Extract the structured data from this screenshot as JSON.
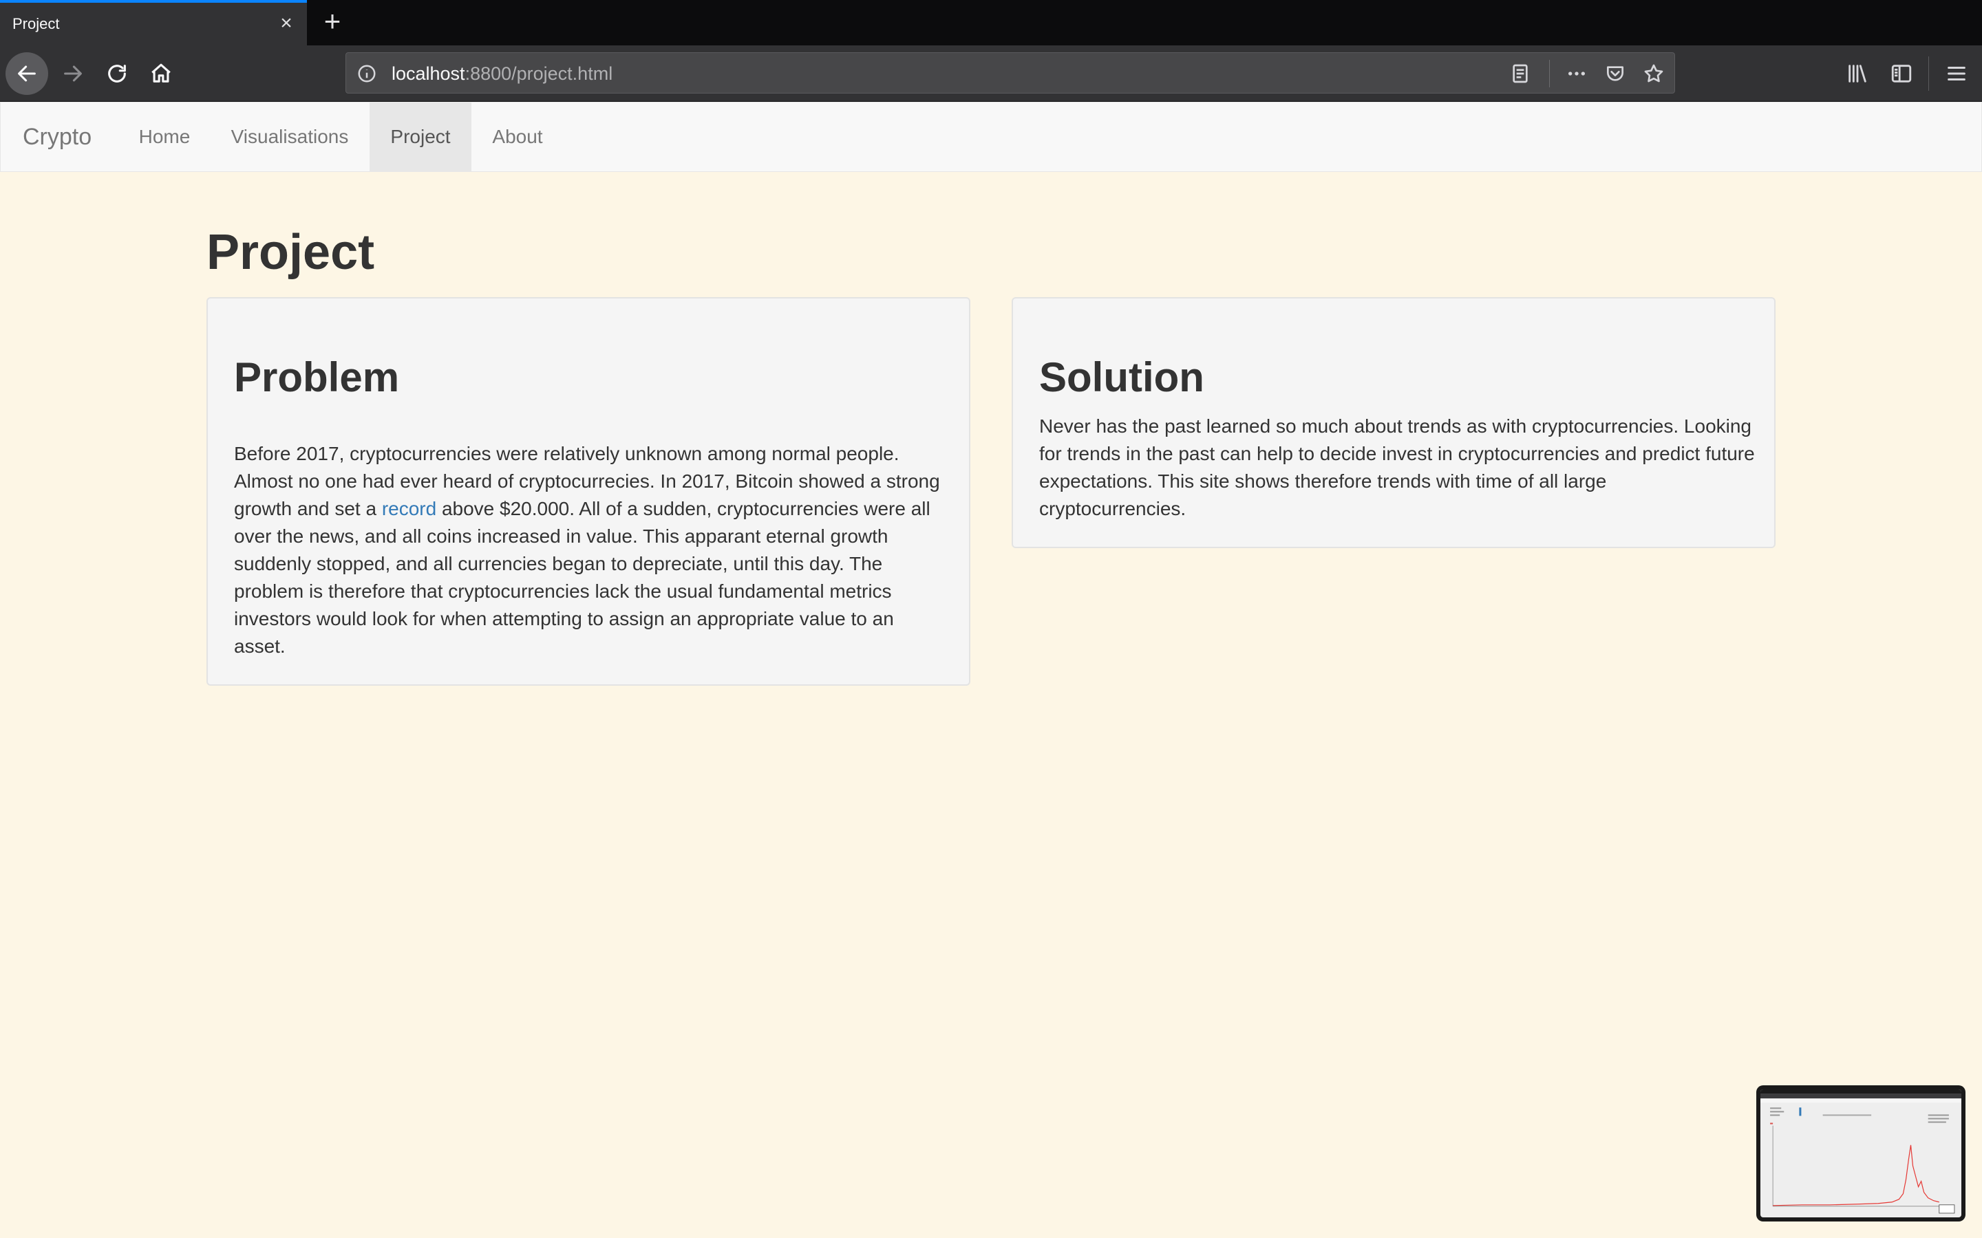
{
  "browser": {
    "tab_title": "Project",
    "tab_close": "×",
    "new_tab": "+",
    "url_host": "localhost",
    "url_path": ":8800/project.html",
    "icons": [
      "back-icon",
      "forward-icon",
      "reload-icon",
      "home-icon",
      "info-icon",
      "reader-view-icon",
      "more-icon",
      "pocket-icon",
      "bookmark-star-icon",
      "library-icon",
      "sidebar-icon",
      "menu-icon"
    ]
  },
  "site_nav": {
    "brand": "Crypto",
    "items": [
      {
        "label": "Home",
        "active": false
      },
      {
        "label": "Visualisations",
        "active": false
      },
      {
        "label": "Project",
        "active": true
      },
      {
        "label": "About",
        "active": false
      }
    ]
  },
  "page": {
    "title": "Project",
    "problem": {
      "heading": "Problem",
      "text_before_link": "Before 2017, cryptocurrencies were relatively unknown among normal people. Almost no one had ever heard of cryptocurrecies. In 2017, Bitcoin showed a strong growth and set a ",
      "link_text": "record",
      "text_after_link": " above $20.000. All of a sudden, cryptocurrencies were all over the news, and all coins increased in value. This apparant eternal growth suddenly stopped, and all currencies began to depreciate, until this day. The problem is therefore that cryptocurrencies lack the usual fundamental metrics investors would look for when attempting to assign an appropriate value to an asset."
    },
    "solution": {
      "heading": "Solution",
      "text": "Never has the past learned so much about trends as with cryptocurrencies. Looking for trends in the past can help to decide invest in cryptocurrencies and predict future expectations. This site shows therefore trends with time of all large cryptocurrencies."
    }
  },
  "colors": {
    "page_background": "#fdf6e5",
    "link": "#337ab7",
    "tab_accent": "#0a84ff"
  }
}
